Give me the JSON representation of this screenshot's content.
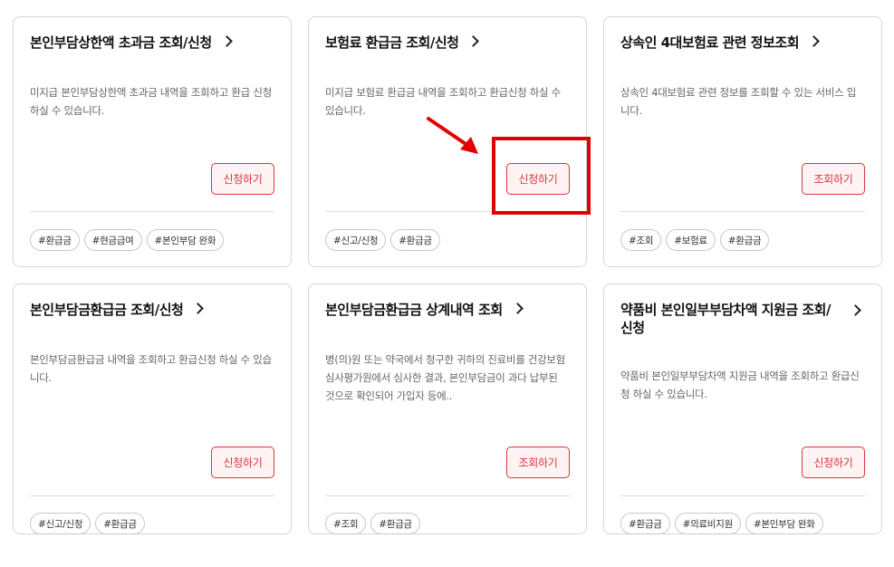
{
  "cards": [
    {
      "title": "본인부담상한액 초과금 조회/신청",
      "description": "미지급 본인부담상한액 초과금 내역을 조회하고 환급 신청 하실 수 있습니다.",
      "button": "신청하기",
      "tags": [
        "#환급금",
        "#현금급여",
        "#본인부담 완화"
      ]
    },
    {
      "title": "보험료 환급금 조회/신청",
      "description": "미지급 보험료 환급금 내역을 조회하고 환급신청 하실 수 있습니다.",
      "button": "신청하기",
      "tags": [
        "#신고/신청",
        "#환급금"
      ]
    },
    {
      "title": "상속인 4대보험료 관련 정보조회",
      "description": "상속인 4대보험료 관련 정보를 조회할 수 있는 서비스 입니다.",
      "button": "조회하기",
      "tags": [
        "#조회",
        "#보험료",
        "#환급금"
      ]
    },
    {
      "title": "본인부담금환급금 조회/신청",
      "description": "본인부담금환급금 내역을 조회하고 환급신청 하실 수 있습니다.",
      "button": "신청하기",
      "tags": [
        "#신고/신청",
        "#환급금"
      ]
    },
    {
      "title": "본인부담금환급금 상계내역 조회",
      "description": "병(의)원 또는 약국에서 청구한 귀하의 진료비를 건강보험심사평가원에서 심사한 결과, 본인부담금이 과다 납부된 것으로 확인되어 가입자 등에..",
      "button": "조회하기",
      "tags": [
        "#조회",
        "#환급금"
      ]
    },
    {
      "title": "약품비 본인일부부담차액 지원금 조회/신청",
      "description": "약품비 본인일부부담차액 지원금 내역을 조회하고 환급신청 하실 수 있습니다.",
      "button": "신청하기",
      "tags": [
        "#환급금",
        "#의료비지원",
        "#본인부담 완화"
      ]
    }
  ],
  "colors": {
    "accent": "#d9363e",
    "highlight": "#e00000"
  }
}
